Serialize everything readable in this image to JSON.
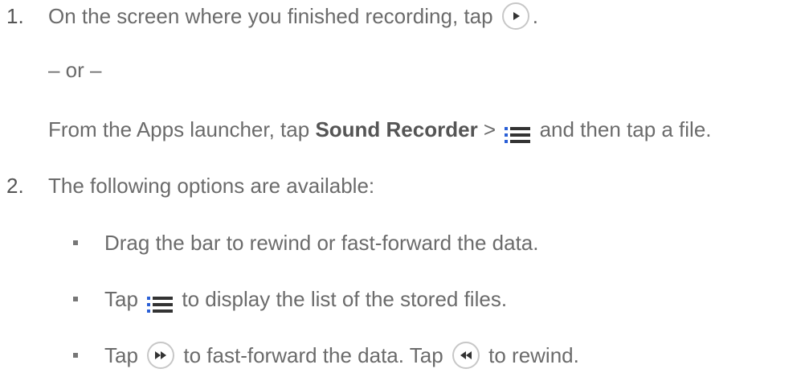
{
  "steps": [
    {
      "number": "1.",
      "text_before_icon": "On the screen where you finished recording, tap",
      "text_after_icon": ".",
      "icon": "play-icon"
    },
    {
      "number": "2.",
      "text": "The following options are available:"
    }
  ],
  "or_separator": "– or –",
  "alt_instruction": {
    "part1": "From the Apps launcher, tap",
    "bold": "Sound Recorder",
    "part2": ">",
    "icon": "list-icon",
    "part3": "and then tap a file."
  },
  "options": [
    {
      "text": "Drag the bar to rewind or fast-forward the data."
    },
    {
      "before": "Tap",
      "icon": "list-icon",
      "after": "to display the list of the stored files."
    },
    {
      "before": "Tap",
      "icon1": "fast-forward-icon",
      "middle": "to fast-forward the data. Tap",
      "icon2": "rewind-icon",
      "after": "to rewind."
    }
  ],
  "colors": {
    "text": "#6b6b6b",
    "icon_dark": "#333333",
    "icon_accent": "#2a5fd6",
    "circle_border": "#c7c7c7"
  }
}
